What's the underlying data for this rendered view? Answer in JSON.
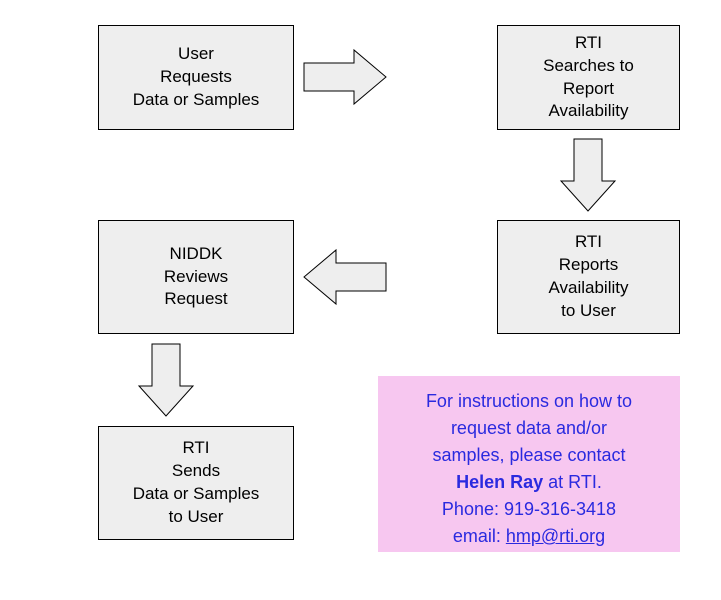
{
  "boxes": {
    "user_request": "User\nRequests\nData or Samples",
    "rti_search": "RTI\nSearches to\nReport\nAvailability",
    "rti_report": "RTI\nReports\nAvailability\nto User",
    "niddk_review": "NIDDK\nReviews\nRequest",
    "rti_send": "RTI\nSends\nData or Samples\nto User"
  },
  "info": {
    "line1": "For instructions on how to",
    "line2": "request data and/or",
    "line3": "samples, please contact",
    "contact_name": "Helen Ray",
    "at_rti": " at RTI.",
    "phone_line": "Phone:  919-316-3418",
    "email_label": "email:  ",
    "email_link": "hmp@rti.org"
  }
}
